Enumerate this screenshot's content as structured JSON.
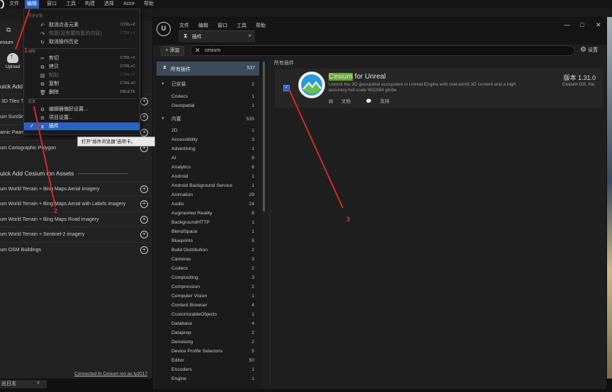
{
  "editor": {
    "menubar": [
      "文件",
      "编辑",
      "窗口",
      "工具",
      "构建",
      "选择",
      "Actor",
      "帮助"
    ],
    "active_menu": "编辑",
    "cesium_tab_label": "esium",
    "upload_label": "Upload",
    "quick_add_basic_title": "uick Add",
    "basic_items": [
      "3D Tiles T",
      "um SunSky",
      "amic Pawn",
      "um Cartographic Polygon"
    ],
    "ion_title": "uick Add Cesium ion Assets",
    "ion_items": [
      "um World Terrain + Bing Maps Aerial imagery",
      "um World Terrain + Bing Maps Aerial with Labels imagery",
      "um World Terrain + Bing Maps Road imagery",
      "um World Terrain + Sentinel-2 imagery",
      "um OSM Buildings"
    ],
    "footer_link": "Connected to Cesium ion as ty2017",
    "log_tab": "出日志",
    "log_close": "×"
  },
  "edit_menu": {
    "section_history": "历史记录",
    "section_edit": "编辑",
    "section_config": "配置",
    "items": [
      {
        "icon": "↶",
        "label": "取消点击元素",
        "shortcut": "CTRL+Z",
        "disabled": false
      },
      {
        "icon": "↷",
        "label": "恢复(没有要恢复的内容)",
        "shortcut": "CTRL+Y",
        "disabled": true
      },
      {
        "icon": "↻",
        "label": "取消操作历史",
        "shortcut": "",
        "disabled": false
      },
      {
        "icon": "✂",
        "label": "剪切",
        "shortcut": "CTRL+X",
        "disabled": false
      },
      {
        "icon": "⧉",
        "label": "拷贝",
        "shortcut": "CTRL+C",
        "disabled": false
      },
      {
        "icon": "▤",
        "label": "粘贴",
        "shortcut": "CTRL+V",
        "disabled": true
      },
      {
        "icon": "⧉",
        "label": "复制",
        "shortcut": "CTRL+D",
        "disabled": false
      },
      {
        "icon": "🗑",
        "label": "删除",
        "shortcut": "DELETE",
        "disabled": false
      },
      {
        "icon": "⚙",
        "label": "编辑器偏好设置...",
        "shortcut": "",
        "disabled": false
      },
      {
        "icon": "⚙",
        "label": "项目设置...",
        "shortcut": "",
        "disabled": false
      },
      {
        "icon": "⧗",
        "label": "插件",
        "shortcut": "",
        "disabled": false,
        "selected": true
      }
    ],
    "tooltip": "打开\"插件浏览器\"选项卡。"
  },
  "plugins": {
    "menubar": [
      "文件",
      "编辑",
      "窗口",
      "工具",
      "帮助"
    ],
    "tab_title": "插件",
    "tab_close": "×",
    "window_controls": [
      "—",
      "□",
      "✕"
    ],
    "add_label": "添加",
    "search_value": "cesium",
    "search_clear": "✕",
    "settings_label": "设置",
    "breadcrumb": "所有插件",
    "all_plugins": {
      "label": "所有插件",
      "count": "537"
    },
    "installed": {
      "label": "已安装",
      "count": "2",
      "items": [
        {
          "name": "Codecs",
          "count": "1"
        },
        {
          "name": "Geospatial",
          "count": "1"
        }
      ]
    },
    "builtin": {
      "label": "内置",
      "count": "535",
      "items": [
        {
          "name": "2D",
          "count": "1"
        },
        {
          "name": "Accessibility",
          "count": "3"
        },
        {
          "name": "Advertising",
          "count": "1"
        },
        {
          "name": "AI",
          "count": "9"
        },
        {
          "name": "Analytics",
          "count": "6"
        },
        {
          "name": "Android",
          "count": "1"
        },
        {
          "name": "Android Background Service",
          "count": "1"
        },
        {
          "name": "Animation",
          "count": "29"
        },
        {
          "name": "Audio",
          "count": "24"
        },
        {
          "name": "Augmented Reality",
          "count": "8"
        },
        {
          "name": "BackgroundHTTP",
          "count": "1"
        },
        {
          "name": "BlendSpace",
          "count": "1"
        },
        {
          "name": "Blueprints",
          "count": "5"
        },
        {
          "name": "Build Distribution",
          "count": "2"
        },
        {
          "name": "Cameras",
          "count": "3"
        },
        {
          "name": "Codecs",
          "count": "2"
        },
        {
          "name": "Compositing",
          "count": "3"
        },
        {
          "name": "Compression",
          "count": "2"
        },
        {
          "name": "Computer Vision",
          "count": "1"
        },
        {
          "name": "Content Browser",
          "count": "4"
        },
        {
          "name": "CustomizableObjects",
          "count": "1"
        },
        {
          "name": "Database",
          "count": "4"
        },
        {
          "name": "Dataprep",
          "count": "2"
        },
        {
          "name": "Denoising",
          "count": "2"
        },
        {
          "name": "Device Profile Selectors",
          "count": "5"
        },
        {
          "name": "Editor",
          "count": "50"
        },
        {
          "name": "Encoders",
          "count": "1"
        },
        {
          "name": "Engine",
          "count": "1"
        }
      ]
    },
    "card": {
      "title_highlight": "Cesium",
      "title_rest": " for Unreal",
      "description": "Unlock the 3D geospatial ecosystem in Unreal Engine with real-world 3D content and a high accuracy full-scale WGS84 globe.",
      "docs": "文档",
      "support": "支持",
      "version": "版本 1.31.0",
      "vendor": "Cesium GS, Inc.",
      "enabled": true
    }
  },
  "annotations": [
    "1",
    "2",
    "3"
  ]
}
